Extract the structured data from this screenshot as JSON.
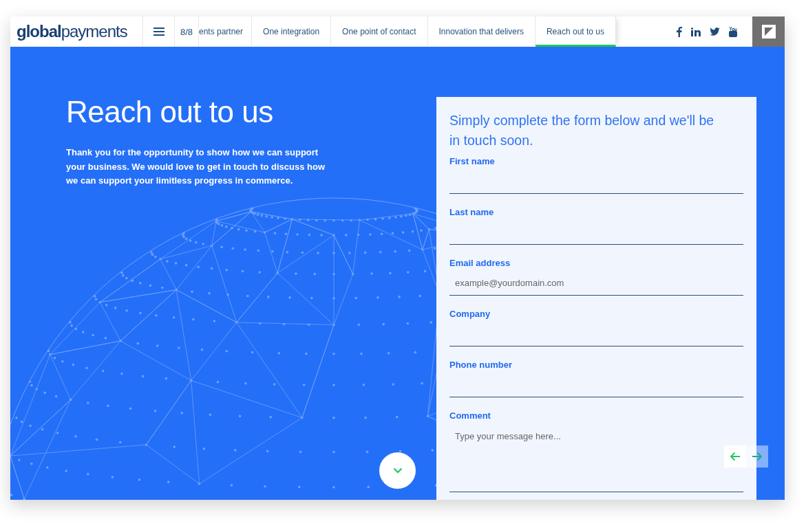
{
  "header": {
    "logo": "**global**payments",
    "counter": "8/8",
    "tabs": [
      {
        "label": "ents partner",
        "selected": false
      },
      {
        "label": "One integration",
        "selected": false
      },
      {
        "label": "One point of contact",
        "selected": false
      },
      {
        "label": "Innovation that delivers",
        "selected": false
      },
      {
        "label": "Reach out to us",
        "selected": true
      }
    ]
  },
  "hero": {
    "title": "Reach out to us",
    "text": "Thank you for the opportunity to show how we can support your business. We would love to get in touch to discuss how we can support your limitless progress in commerce."
  },
  "form": {
    "intro": "Simply complete the form below and we'll be in touch soon.",
    "fields": [
      {
        "label": "First name",
        "kind": "input"
      },
      {
        "label": "Last name",
        "kind": "input"
      },
      {
        "label": "Email address",
        "kind": "input",
        "placeholder": "example@yourdomain.com"
      },
      {
        "label": "Company",
        "kind": "input"
      },
      {
        "label": "Phone number",
        "kind": "input"
      },
      {
        "label": "Comment",
        "kind": "textarea",
        "placeholder": "Type your message here..."
      }
    ]
  }
}
